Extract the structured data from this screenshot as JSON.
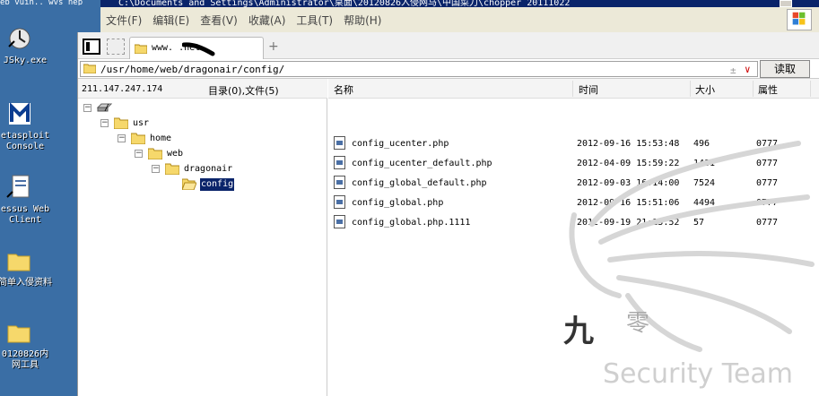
{
  "desktop": {
    "top_strip": "eb vuin..  wvs nep",
    "icons": [
      {
        "label": "JSky.exe"
      },
      {
        "label": "etasploit Console"
      },
      {
        "label": "essus Web Client"
      },
      {
        "label": "简单入侵资料"
      },
      {
        "label": "0120826内网工具"
      }
    ]
  },
  "outer_window": {
    "title": "C:\\Documents and Settings\\Administrator\\桌面\\20120826入侵网马\\中国菜刀\\chopper 20111022",
    "menu": [
      "文件(F)",
      "编辑(E)",
      "查看(V)",
      "收藏(A)",
      "工具(T)",
      "帮助(H)"
    ]
  },
  "tab": {
    "title": "www.    .net",
    "add": "+"
  },
  "path": {
    "value": "/usr/home/web/dragonair/config/",
    "read_label": "读取",
    "ctrl1": "±",
    "ctrl2": "∨"
  },
  "tree": {
    "ip": "211.147.247.174",
    "count": "目录(0),文件(5)",
    "nodes": [
      {
        "name": "/",
        "expanded": true
      },
      {
        "name": "usr",
        "expanded": true
      },
      {
        "name": "home",
        "expanded": true
      },
      {
        "name": "web",
        "expanded": true
      },
      {
        "name": "dragonair",
        "expanded": true
      },
      {
        "name": "config",
        "selected": true
      }
    ]
  },
  "files": {
    "columns": {
      "name": "名称",
      "time": "时间",
      "size": "大小",
      "attr": "属性"
    },
    "rows": [
      {
        "name": "config_ucenter.php",
        "time": "2012-09-16 15:53:48",
        "size": "496",
        "attr": "0777"
      },
      {
        "name": "config_ucenter_default.php",
        "time": "2012-04-09 15:59:22",
        "size": "1481",
        "attr": "0777"
      },
      {
        "name": "config_global_default.php",
        "time": "2012-09-03 16:14:00",
        "size": "7524",
        "attr": "0777"
      },
      {
        "name": "config_global.php",
        "time": "2012-09-16 15:51:06",
        "size": "4494",
        "attr": "0777"
      },
      {
        "name": "config_global.php.1111",
        "time": "2012-09-19 21:13:52",
        "size": "57",
        "attr": "0777"
      }
    ]
  },
  "watermark": {
    "text": "Security Team",
    "glyph1": "九",
    "glyph2": "零"
  }
}
